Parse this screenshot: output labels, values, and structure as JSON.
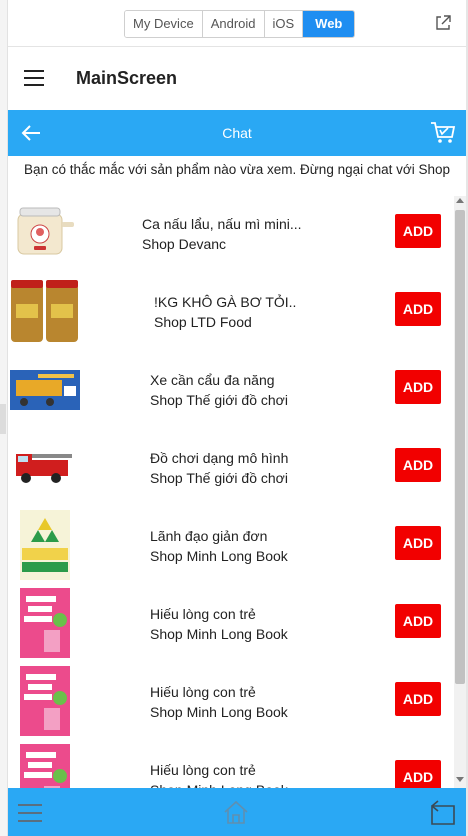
{
  "device_bar": {
    "tabs": [
      "My Device",
      "Android",
      "iOS",
      "Web"
    ],
    "active_tab": "Web"
  },
  "header": {
    "title": "MainScreen"
  },
  "chat_bar": {
    "title": "Chat"
  },
  "info_text": "Bạn có thắc mắc với sản phẩm nào vừa xem. Đừng ngại chat với Shop",
  "add_label": "ADD",
  "products": [
    {
      "name": "Ca nấu lẩu, nấu mì mini...",
      "shop": "Shop Devanc",
      "thumb": "kettle-image"
    },
    {
      "name": "!KG KHÔ GÀ BƠ TỎI..",
      "shop": "Shop LTD Food",
      "thumb": "jars-image"
    },
    {
      "name": "Xe cần cẩu đa năng",
      "shop": "Shop Thế giới đồ chơi",
      "thumb": "crane-toy-image"
    },
    {
      "name": "Đồ chơi dạng mô hình",
      "shop": "Shop Thế giới đồ chơi",
      "thumb": "fire-truck-image"
    },
    {
      "name": "Lãnh đạo giản đơn",
      "shop": "Shop Minh Long Book",
      "thumb": "book-leadership-image"
    },
    {
      "name": "Hiếu lòng con trẻ",
      "shop": "Shop Minh Long Book",
      "thumb": "book-child-image"
    },
    {
      "name": "Hiếu lòng con trẻ",
      "shop": "Shop Minh Long Book",
      "thumb": "book-child-image"
    },
    {
      "name": "Hiếu lòng con trẻ",
      "shop": "Shop Minh Long Book",
      "thumb": "book-child-image"
    }
  ],
  "colors": {
    "brand_blue": "#2aa8f4",
    "add_red": "#f20000",
    "active_tab": "#1f8ef1"
  },
  "icons": {
    "popout": "external-link-icon",
    "menu": "hamburger-icon",
    "back": "arrow-left-icon",
    "cart": "shopping-cart-icon",
    "home": "home-icon",
    "nav_back": "return-icon"
  }
}
